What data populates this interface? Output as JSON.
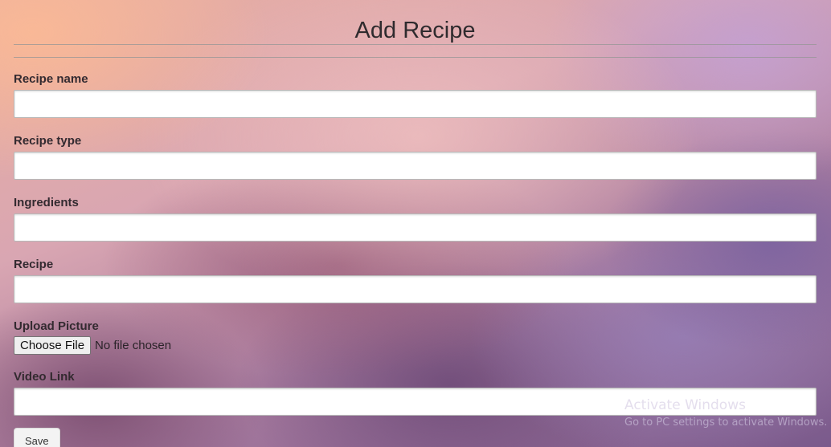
{
  "page": {
    "title": "Add Recipe"
  },
  "form": {
    "recipe_name": {
      "label": "Recipe name",
      "value": "",
      "placeholder": ""
    },
    "recipe_type": {
      "label": "Recipe type",
      "value": "",
      "placeholder": ""
    },
    "ingredients": {
      "label": "Ingredients",
      "value": "",
      "placeholder": ""
    },
    "recipe": {
      "label": "Recipe",
      "value": "",
      "placeholder": ""
    },
    "upload_picture": {
      "label": "Upload Picture",
      "button_label": "Choose File",
      "status": "No file chosen"
    },
    "video_link": {
      "label": "Video Link",
      "value": "",
      "placeholder": ""
    },
    "save_label": "Save"
  },
  "watermark": {
    "title": "Activate Windows",
    "subtitle": "Go to PC settings to activate Windows."
  }
}
